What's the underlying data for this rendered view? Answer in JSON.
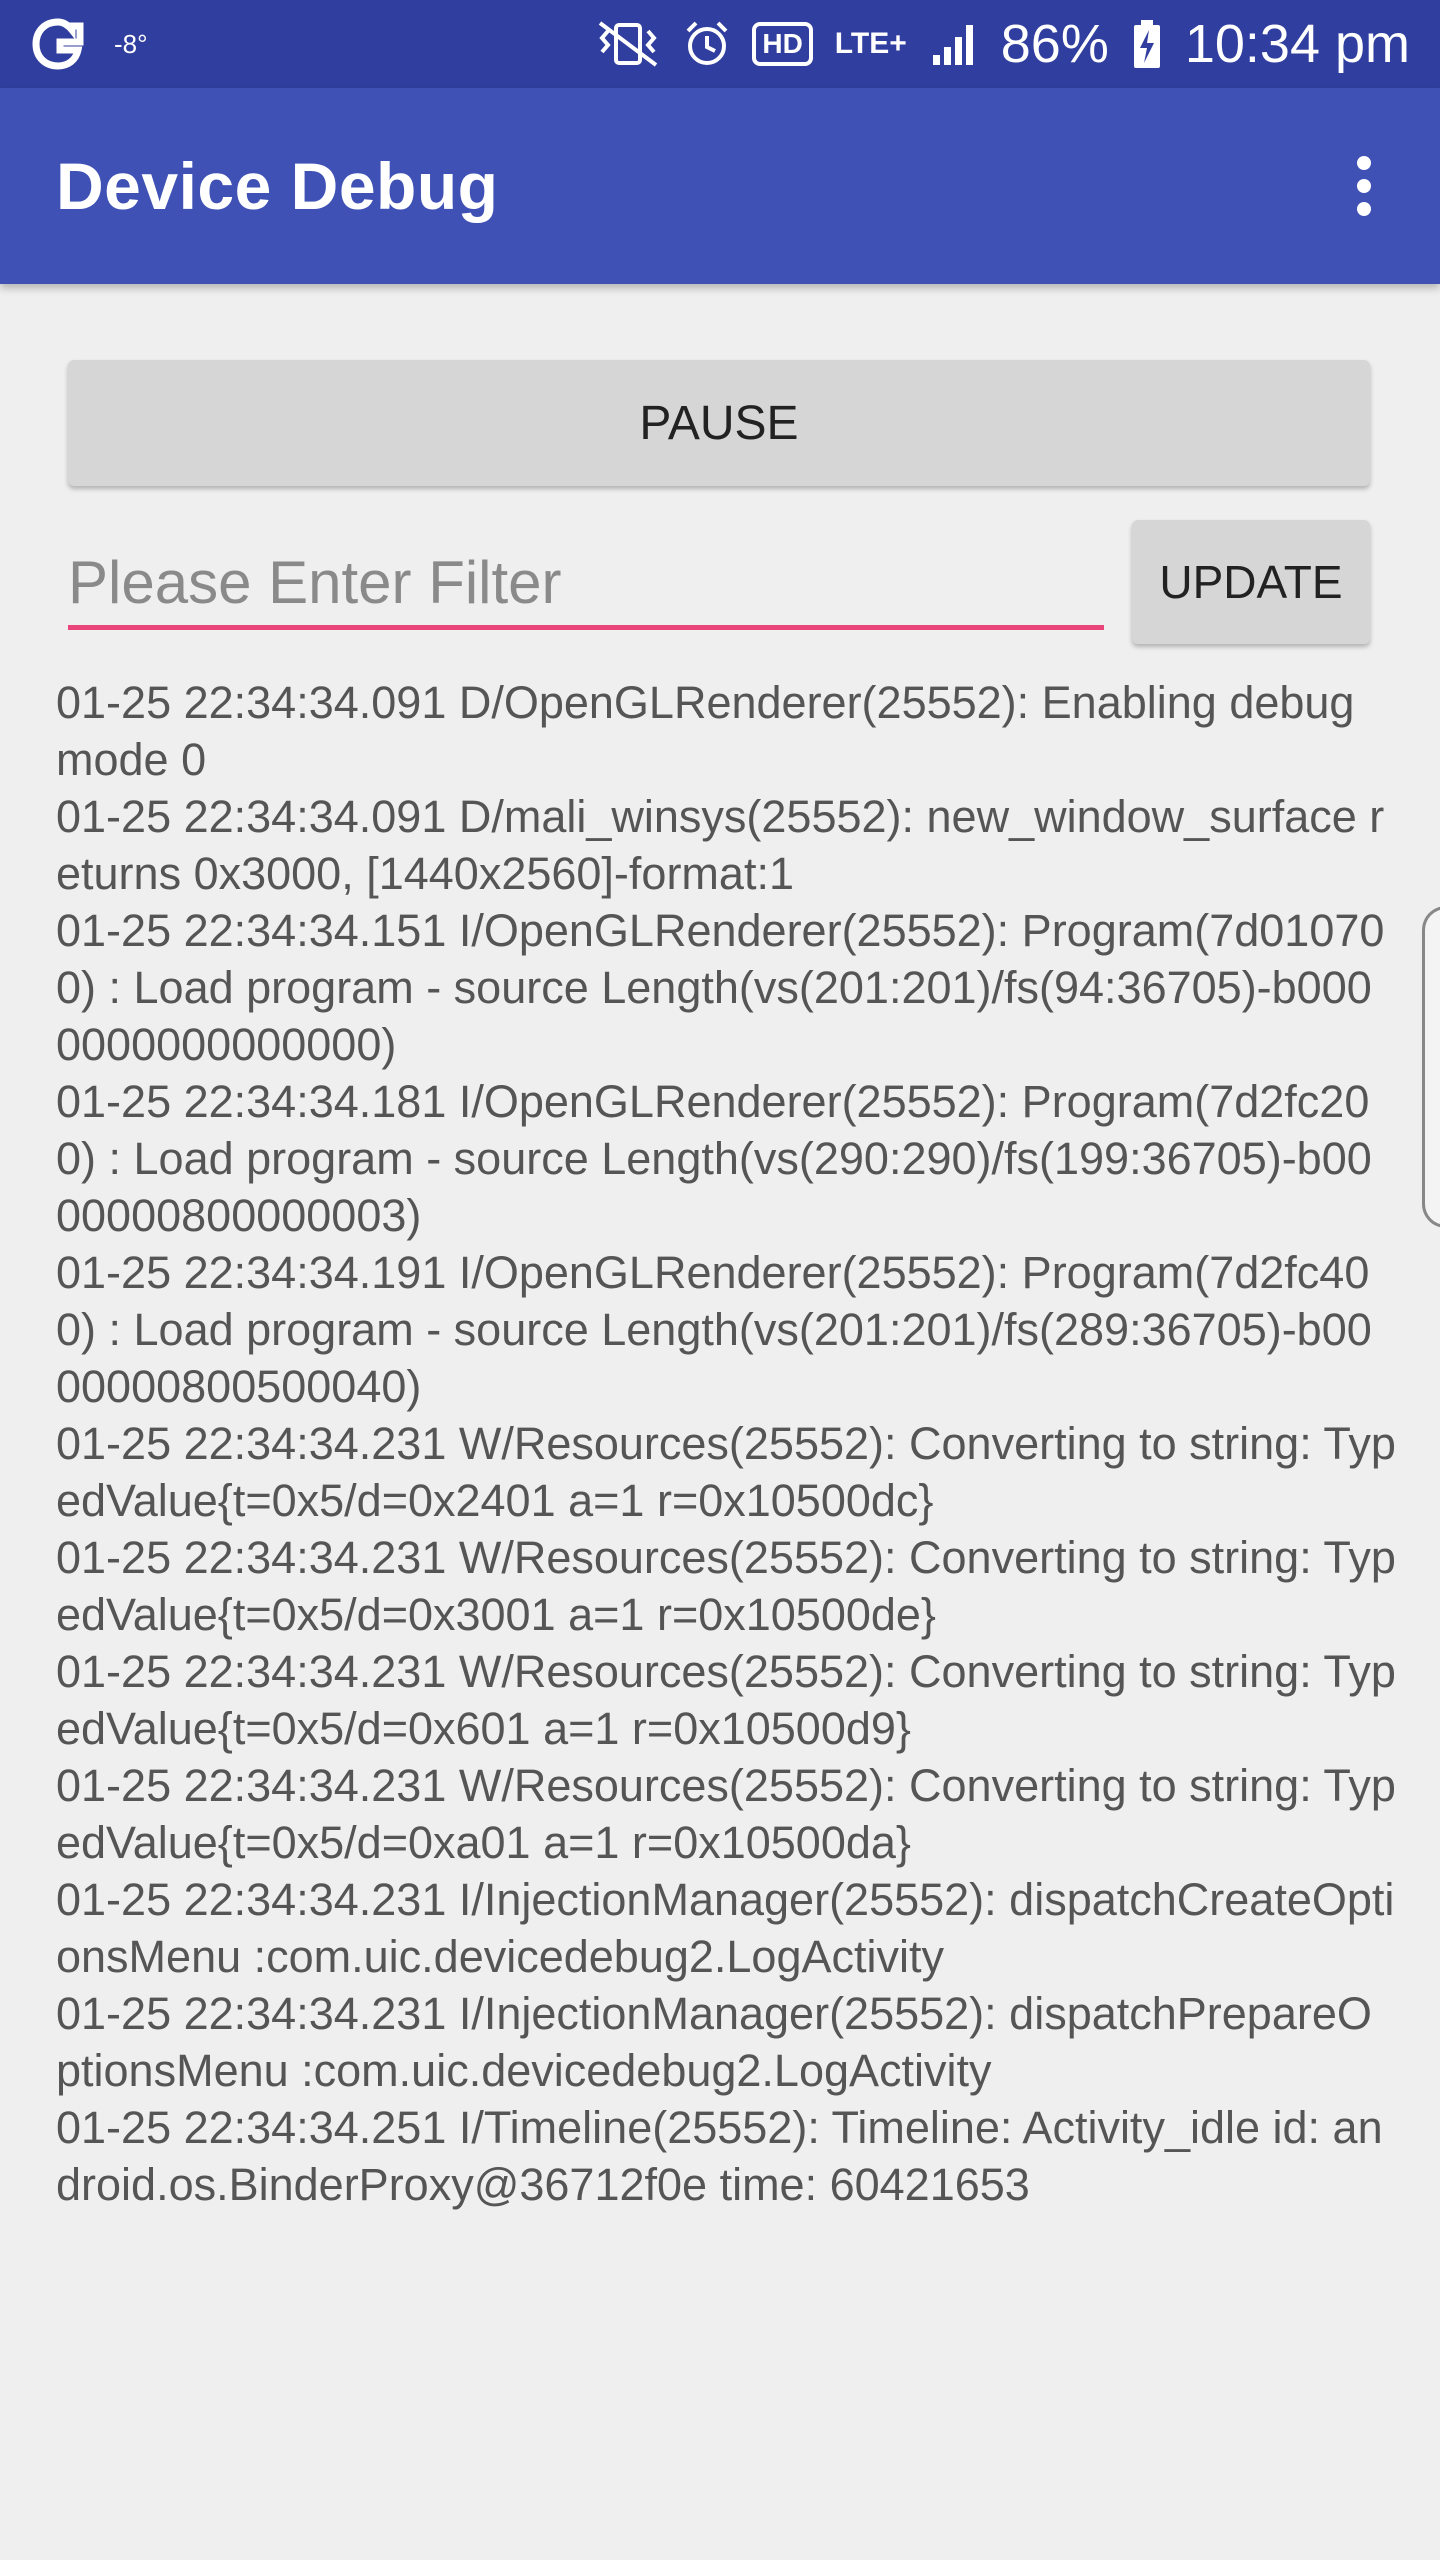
{
  "status_bar": {
    "temperature": "-8°",
    "hd_badge": "HD",
    "lte_badge": "LTE+",
    "battery": "86%",
    "time": "10:34 pm",
    "icons": [
      "app-logo-icon",
      "vibrate-icon",
      "alarm-icon",
      "signal-icon",
      "battery-charging-icon"
    ]
  },
  "app_bar": {
    "title": "Device Debug",
    "menu_icon": "overflow-menu-icon"
  },
  "controls": {
    "pause_label": "PAUSE",
    "filter_placeholder": "Please Enter Filter",
    "filter_value": "",
    "update_label": "UPDATE"
  },
  "colors": {
    "status_bar": "#303f9f",
    "app_bar": "#3f51b5",
    "filter_underline": "#e9457a"
  },
  "log": {
    "entries": [
      "01-25 22:34:34.091 D/OpenGLRenderer(25552): Enabling debug mode 0",
      "01-25 22:34:34.091 D/mali_winsys(25552): new_window_surface returns 0x3000, [1440x2560]-format:1",
      "01-25 22:34:34.151 I/OpenGLRenderer(25552): Program(7d010700) : Load program - source Length(vs(201:201)/fs(94:36705)-b0000000000000000)",
      "01-25 22:34:34.181 I/OpenGLRenderer(25552): Program(7d2fc200) : Load program - source Length(vs(290:290)/fs(199:36705)-b0000000800000003)",
      "01-25 22:34:34.191 I/OpenGLRenderer(25552): Program(7d2fc400) : Load program - source Length(vs(201:201)/fs(289:36705)-b0000000800500040)",
      "01-25 22:34:34.231 W/Resources(25552): Converting to string: TypedValue{t=0x5/d=0x2401 a=1 r=0x10500dc}",
      "01-25 22:34:34.231 W/Resources(25552): Converting to string: TypedValue{t=0x5/d=0x3001 a=1 r=0x10500de}",
      "01-25 22:34:34.231 W/Resources(25552): Converting to string: TypedValue{t=0x5/d=0x601 a=1 r=0x10500d9}",
      "01-25 22:34:34.231 W/Resources(25552): Converting to string: TypedValue{t=0x5/d=0xa01 a=1 r=0x10500da}",
      "01-25 22:34:34.231 I/InjectionManager(25552): dispatchCreateOptionsMenu :com.uic.devicedebug2.LogActivity",
      "01-25 22:34:34.231 I/InjectionManager(25552): dispatchPrepareOptionsMenu :com.uic.devicedebug2.LogActivity",
      "01-25 22:34:34.251 I/Timeline(25552): Timeline: Activity_idle id: android.os.BinderProxy@36712f0e time: 60421653"
    ]
  }
}
